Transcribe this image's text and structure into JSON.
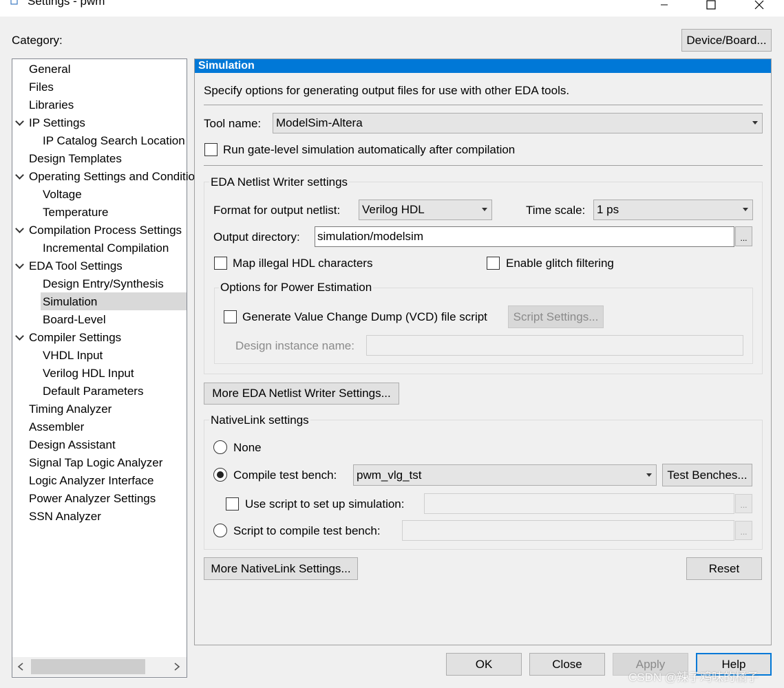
{
  "window": {
    "title": "Settings - pwm"
  },
  "category_label": "Category:",
  "device_board_button": "Device/Board...",
  "tree": {
    "items": [
      {
        "label": "General"
      },
      {
        "label": "Files"
      },
      {
        "label": "Libraries"
      },
      {
        "label": "IP Settings"
      },
      {
        "label": "IP Catalog Search Location"
      },
      {
        "label": "Design Templates"
      },
      {
        "label": "Operating Settings and Conditions"
      },
      {
        "label": "Voltage"
      },
      {
        "label": "Temperature"
      },
      {
        "label": "Compilation Process Settings"
      },
      {
        "label": "Incremental Compilation"
      },
      {
        "label": "EDA Tool Settings"
      },
      {
        "label": "Design Entry/Synthesis"
      },
      {
        "label": "Simulation"
      },
      {
        "label": "Board-Level"
      },
      {
        "label": "Compiler Settings"
      },
      {
        "label": "VHDL Input"
      },
      {
        "label": "Verilog HDL Input"
      },
      {
        "label": "Default Parameters"
      },
      {
        "label": "Timing Analyzer"
      },
      {
        "label": "Assembler"
      },
      {
        "label": "Design Assistant"
      },
      {
        "label": "Signal Tap Logic Analyzer"
      },
      {
        "label": "Logic Analyzer Interface"
      },
      {
        "label": "Power Analyzer Settings"
      },
      {
        "label": "SSN Analyzer"
      }
    ],
    "selected": "Simulation"
  },
  "panel": {
    "header": "Simulation",
    "description": "Specify options for generating output files for use with other EDA tools.",
    "tool_name_label": "Tool name:",
    "tool_name_value": "ModelSim-Altera",
    "run_gate_level_label": "Run gate-level simulation automatically after compilation",
    "run_gate_level_checked": false,
    "netlist": {
      "group_title": "EDA Netlist Writer settings",
      "format_label": "Format for output netlist:",
      "format_value": "Verilog HDL",
      "timescale_label": "Time scale:",
      "timescale_value": "1 ps",
      "outdir_label": "Output directory:",
      "outdir_value": "simulation/modelsim",
      "browse_label": "...",
      "map_illegal_label": "Map illegal HDL characters",
      "map_illegal_checked": false,
      "glitch_label": "Enable glitch filtering",
      "glitch_checked": false,
      "power": {
        "group_title": "Options for Power Estimation",
        "vcd_label": "Generate Value Change Dump (VCD) file script",
        "vcd_checked": false,
        "script_settings_button": "Script Settings...",
        "design_instance_label": "Design instance name:",
        "design_instance_value": ""
      },
      "more_button": "More EDA Netlist Writer Settings..."
    },
    "nativelink": {
      "group_title": "NativeLink settings",
      "none_label": "None",
      "compile_tb_label": "Compile test bench:",
      "compile_tb_value": "pwm_vlg_tst",
      "selected_option": "compile_test_bench",
      "test_benches_button": "Test Benches...",
      "use_script_label": "Use script to set up simulation:",
      "use_script_checked": false,
      "use_script_value": "",
      "script_compile_label": "Script to compile test bench:",
      "script_compile_value": "",
      "browse_label": "...",
      "more_button": "More NativeLink Settings...",
      "reset_button": "Reset"
    }
  },
  "footer": {
    "ok": "OK",
    "close": "Close",
    "apply": "Apply",
    "help": "Help"
  },
  "watermark": "CSDN @辣子鸡味的橘子",
  "icons": [
    "app-icon",
    "minimize-icon",
    "maximize-icon",
    "close-icon",
    "chevron-down-icon",
    "dropdown-arrow-icon",
    "scroll-left-icon",
    "scroll-right-icon"
  ]
}
